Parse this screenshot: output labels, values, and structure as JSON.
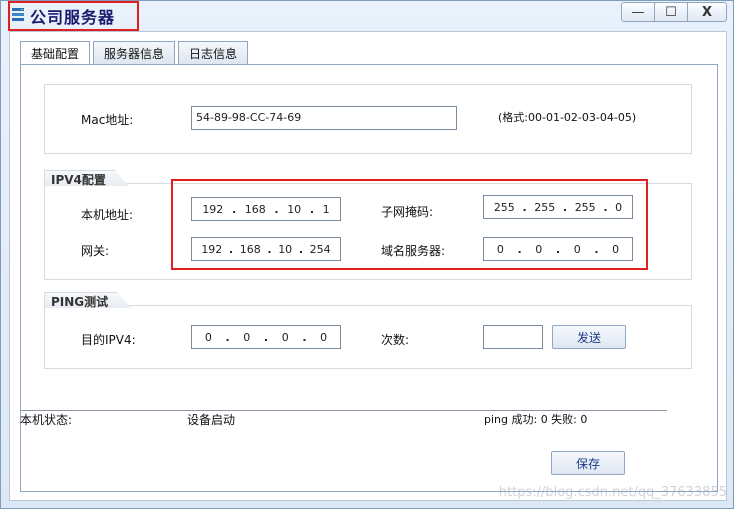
{
  "window": {
    "title": "公司服务器",
    "buttons": {
      "minimize": "—",
      "maximize": "☐",
      "close": "X"
    }
  },
  "tabs": [
    {
      "label": "基础配置",
      "active": true
    },
    {
      "label": "服务器信息",
      "active": false
    },
    {
      "label": "日志信息",
      "active": false
    }
  ],
  "mac": {
    "label": "Mac地址:",
    "value": "54-89-98-CC-74-69",
    "format_hint": "(格式:00-01-02-03-04-05)"
  },
  "ipv4": {
    "caption": "IPV4配置",
    "local_ip_label": "本机地址:",
    "local_ip": [
      "192",
      "168",
      "10",
      "1"
    ],
    "gateway_label": "网关:",
    "gateway": [
      "192",
      "168",
      "10",
      "254"
    ],
    "subnet_label": "子网掩码:",
    "subnet": [
      "255",
      "255",
      "255",
      "0"
    ],
    "dns_label": "域名服务器:",
    "dns": [
      "0",
      "0",
      "0",
      "0"
    ]
  },
  "ping": {
    "caption": "PING测试",
    "target_label": "目的IPV4:",
    "target": [
      "0",
      "0",
      "0",
      "0"
    ],
    "count_label": "次数:",
    "count_value": "",
    "send_button": "发送"
  },
  "status": {
    "label": "本机状态:",
    "value": "设备启动",
    "ping_result": "ping 成功: 0 失败: 0"
  },
  "save_button": "保存",
  "watermark": "https://blog.csdn.net/qq_37633855",
  "colors": {
    "highlight": "#e02020",
    "title_text": "#1a1a6e",
    "button_text": "#1b3b8a"
  },
  "icons": {
    "app": "server-app-icon"
  }
}
